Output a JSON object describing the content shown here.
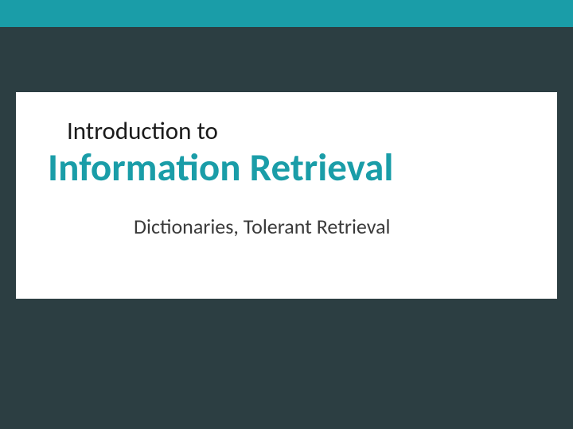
{
  "slide": {
    "pretitle": "Introduction to",
    "title": "Information Retrieval",
    "subtitle": "Dictionaries, Tolerant Retrieval"
  }
}
